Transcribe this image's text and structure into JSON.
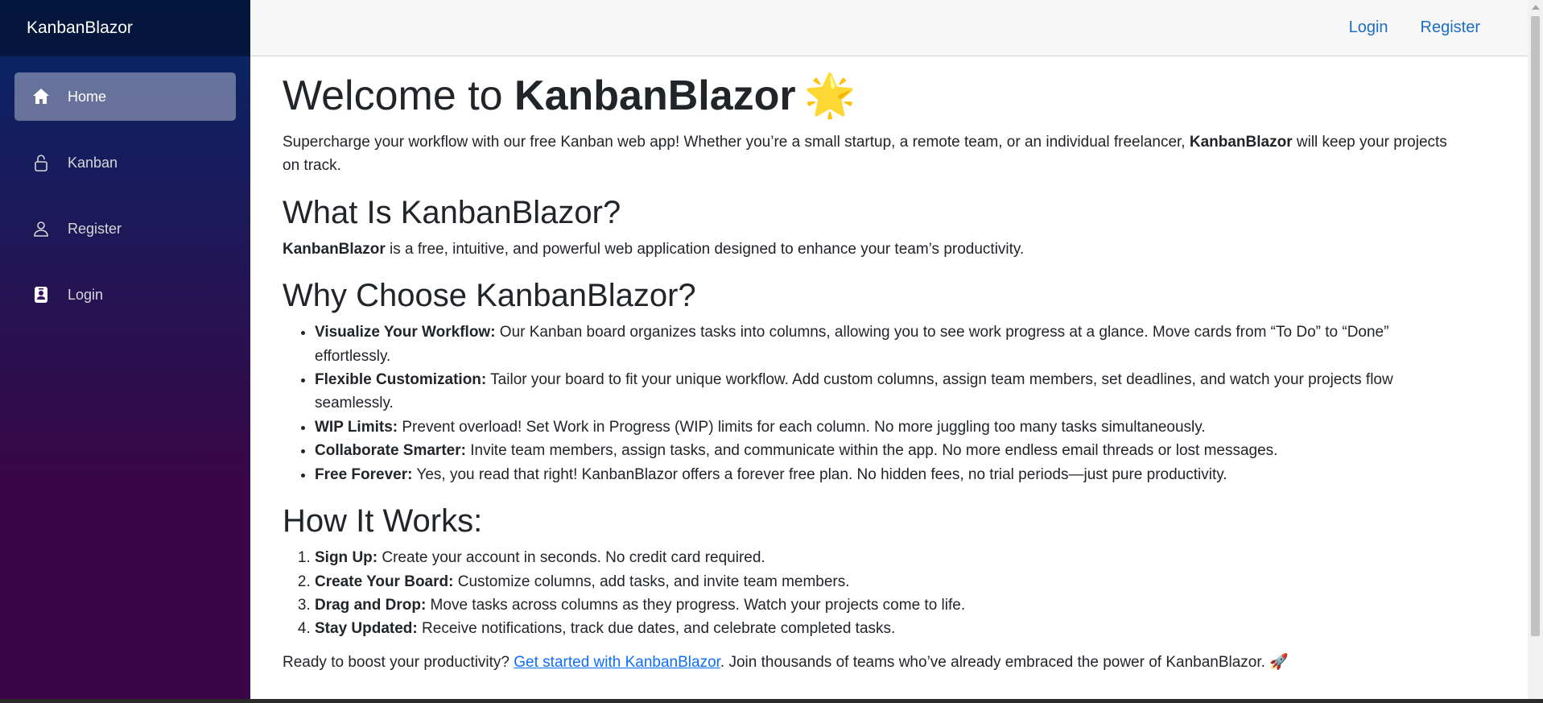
{
  "sidebar": {
    "brand": "KanbanBlazor",
    "items": [
      {
        "label": "Home",
        "icon": "home-icon"
      },
      {
        "label": "Kanban",
        "icon": "lock-icon"
      },
      {
        "label": "Register",
        "icon": "person-icon"
      },
      {
        "label": "Login",
        "icon": "badge-icon"
      }
    ]
  },
  "topbar": {
    "login": "Login",
    "register": "Register"
  },
  "content": {
    "title_prefix": "Welcome to ",
    "title_brand": "KanbanBlazor",
    "title_emoji": "🌟",
    "intro_before": "Supercharge your workflow with our free Kanban web app! Whether you’re a small startup, a remote team, or an individual freelancer, ",
    "intro_brand": "KanbanBlazor",
    "intro_after": " will keep your projects on track.",
    "what_heading": "What Is KanbanBlazor?",
    "what_brand": "KanbanBlazor",
    "what_text": " is a free, intuitive, and powerful web application designed to enhance your team’s productivity.",
    "why_heading": "Why Choose KanbanBlazor?",
    "why_items": [
      {
        "bold": "Visualize Your Workflow:",
        "text": " Our Kanban board organizes tasks into columns, allowing you to see work progress at a glance. Move cards from “To Do” to “Done” effortlessly."
      },
      {
        "bold": "Flexible Customization:",
        "text": " Tailor your board to fit your unique workflow. Add custom columns, assign team members, set deadlines, and watch your projects flow seamlessly."
      },
      {
        "bold": "WIP Limits:",
        "text": " Prevent overload! Set Work in Progress (WIP) limits for each column. No more juggling too many tasks simultaneously."
      },
      {
        "bold": "Collaborate Smarter:",
        "text": " Invite team members, assign tasks, and communicate within the app. No more endless email threads or lost messages."
      },
      {
        "bold": "Free Forever:",
        "text": " Yes, you read that right! KanbanBlazor offers a forever free plan. No hidden fees, no trial periods—just pure productivity."
      }
    ],
    "how_heading": "How It Works:",
    "how_items": [
      {
        "bold": "Sign Up:",
        "text": " Create your account in seconds. No credit card required."
      },
      {
        "bold": "Create Your Board:",
        "text": " Customize columns, add tasks, and invite team members."
      },
      {
        "bold": "Drag and Drop:",
        "text": " Move tasks across columns as they progress. Watch your projects come to life."
      },
      {
        "bold": "Stay Updated:",
        "text": " Receive notifications, track due dates, and celebrate completed tasks."
      }
    ],
    "cta_before": "Ready to boost your productivity? ",
    "cta_link": "Get started with KanbanBlazor",
    "cta_after": ". Join thousands of teams who’ve already embraced the power of KanbanBlazor. 🚀"
  },
  "colors": {
    "sidebar_top": "#052767",
    "sidebar_bottom": "#3a0647",
    "link": "#1b6ec2"
  }
}
